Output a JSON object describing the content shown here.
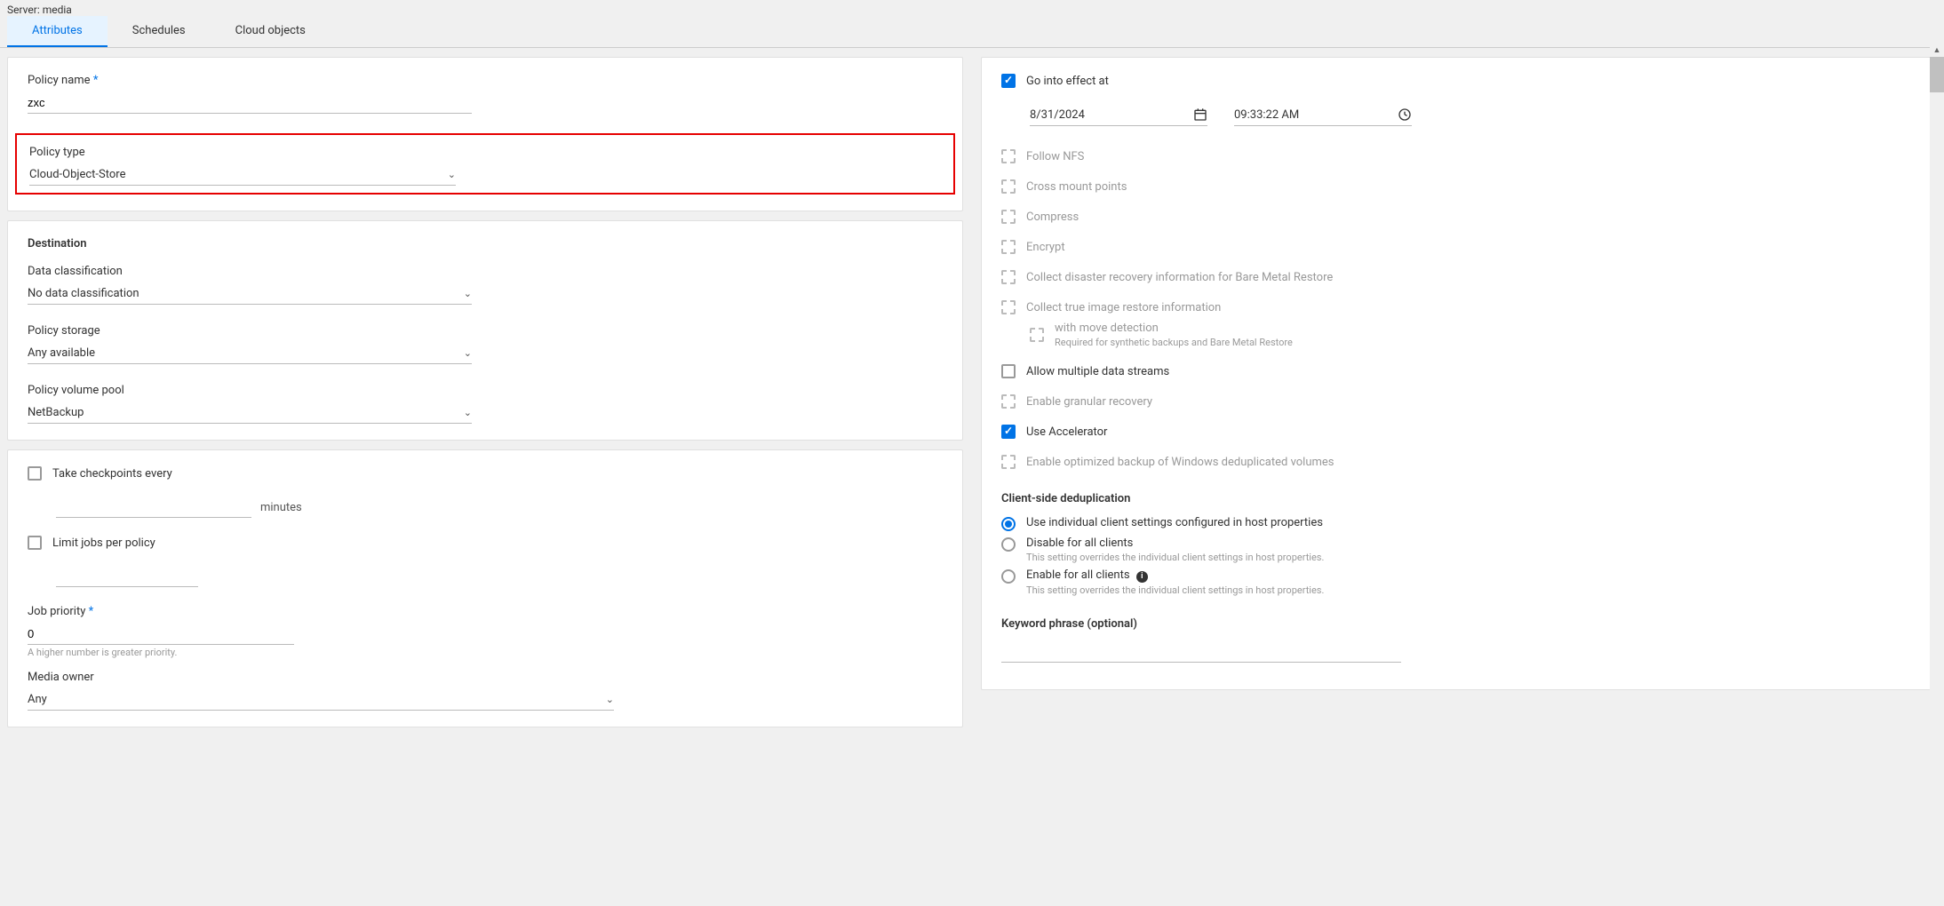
{
  "header": {
    "server_label": "Server: media"
  },
  "tabs": {
    "attributes": "Attributes",
    "schedules": "Schedules",
    "cloud_objects": "Cloud objects"
  },
  "left": {
    "policy_name_label": "Policy name",
    "policy_name_value": "zxc",
    "policy_type_label": "Policy type",
    "policy_type_value": "Cloud-Object-Store",
    "destination_title": "Destination",
    "data_classification_label": "Data classification",
    "data_classification_value": "No data classification",
    "policy_storage_label": "Policy storage",
    "policy_storage_value": "Any available",
    "policy_volume_pool_label": "Policy volume pool",
    "policy_volume_pool_value": "NetBackup",
    "take_checkpoints_label": "Take checkpoints every",
    "minutes_label": "minutes",
    "limit_jobs_label": "Limit jobs per policy",
    "job_priority_label": "Job priority",
    "job_priority_value": "0",
    "job_priority_hint": "A higher number is greater priority.",
    "media_owner_label": "Media owner",
    "media_owner_value": "Any"
  },
  "right": {
    "go_into_effect_label": "Go into effect at",
    "date_value": "8/31/2024",
    "time_value": "09:33:22 AM",
    "follow_nfs": "Follow NFS",
    "cross_mount": "Cross mount points",
    "compress": "Compress",
    "encrypt": "Encrypt",
    "collect_dr": "Collect disaster recovery information for Bare Metal Restore",
    "collect_true_image": "Collect true image restore information",
    "with_move_detection": "with move detection",
    "with_move_hint": "Required for synthetic backups and Bare Metal Restore",
    "allow_multiple": "Allow multiple data streams",
    "enable_granular": "Enable granular recovery",
    "use_accelerator": "Use Accelerator",
    "enable_optimized": "Enable optimized backup of Windows deduplicated volumes",
    "client_dedup_title": "Client-side deduplication",
    "radio_individual": "Use individual client settings configured in host properties",
    "radio_disable": "Disable for all clients",
    "radio_disable_hint": "This setting overrides the individual client settings in host properties.",
    "radio_enable": "Enable for all clients",
    "radio_enable_hint": "This setting overrides the individual client settings in host properties.",
    "keyword_label": "Keyword phrase (optional)"
  }
}
